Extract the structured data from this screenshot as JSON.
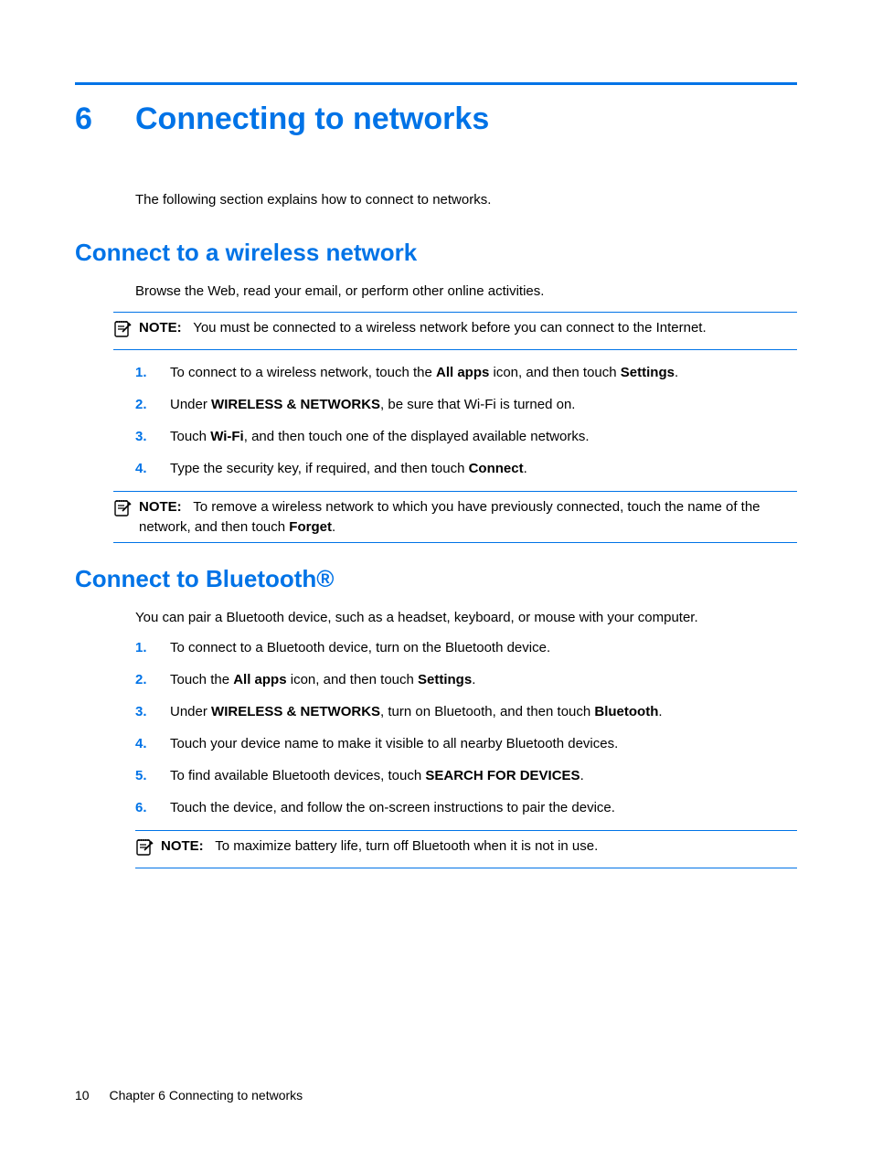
{
  "chapter": {
    "number": "6",
    "title": "Connecting to networks",
    "intro": "The following section explains how to connect to networks."
  },
  "wifi": {
    "heading": "Connect to a wireless network",
    "intro": "Browse the Web, read your email, or perform other online activities.",
    "note1": {
      "label": "NOTE:",
      "text": "You must be connected to a wireless network before you can connect to the Internet."
    },
    "steps": {
      "s1_a": "To connect to a wireless network, touch the ",
      "s1_b_bold": "All apps",
      "s1_c": " icon, and then touch ",
      "s1_d_bold": "Settings",
      "s1_e": ".",
      "s2_a": "Under ",
      "s2_b_bold": "WIRELESS & NETWORKS",
      "s2_c": ", be sure that Wi-Fi is turned on.",
      "s3_a": "Touch ",
      "s3_b_bold": "Wi-Fi",
      "s3_c": ", and then touch one of the displayed available networks.",
      "s4_a": "Type the security key, if required, and then touch ",
      "s4_b_bold": "Connect",
      "s4_c": "."
    },
    "note2": {
      "label": "NOTE:",
      "text_a": "To remove a wireless network to which you have previously connected, touch the name of the network, and then touch ",
      "text_b_bold": "Forget",
      "text_c": "."
    }
  },
  "bt": {
    "heading": "Connect to Bluetooth®",
    "intro": "You can pair a Bluetooth device, such as a headset, keyboard, or mouse with your computer.",
    "steps": {
      "s1": "To connect to a Bluetooth device, turn on the Bluetooth device.",
      "s2_a": "Touch the ",
      "s2_b_bold": "All apps",
      "s2_c": " icon, and then touch ",
      "s2_d_bold": "Settings",
      "s2_e": ".",
      "s3_a": "Under ",
      "s3_b_bold": "WIRELESS & NETWORKS",
      "s3_c": ", turn on Bluetooth, and then touch ",
      "s3_d_bold": "Bluetooth",
      "s3_e": ".",
      "s4": "Touch your device name to make it visible to all nearby Bluetooth devices.",
      "s5_a": "To find available Bluetooth devices, touch ",
      "s5_b_bold": "SEARCH FOR DEVICES",
      "s5_c": ".",
      "s6": "Touch the device, and follow the on-screen instructions to pair the device."
    },
    "note": {
      "label": "NOTE:",
      "text": "To maximize battery life, turn off Bluetooth when it is not in use."
    }
  },
  "footer": {
    "page": "10",
    "text": "Chapter 6   Connecting to networks"
  }
}
